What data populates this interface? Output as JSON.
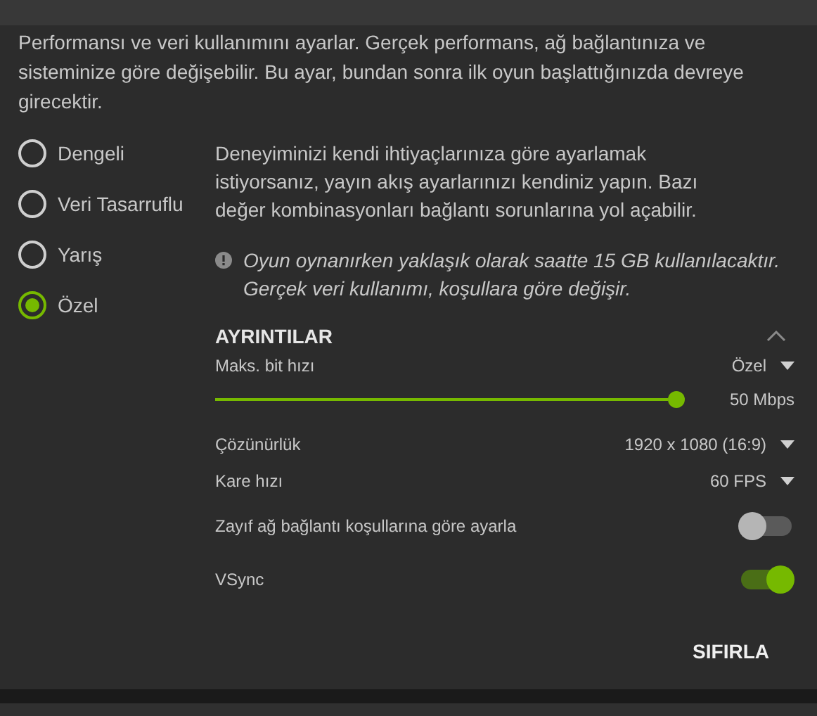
{
  "description": "Performansı ve veri kullanımını ayarlar. Gerçek performans, ağ bağlantınıza ve sisteminize göre değişebilir. Bu ayar, bundan sonra ilk oyun başlattığınızda devreye girecektir.",
  "presets": [
    {
      "label": "Dengeli",
      "selected": false
    },
    {
      "label": "Veri Tasarruflu",
      "selected": false
    },
    {
      "label": "Yarış",
      "selected": false
    },
    {
      "label": "Özel",
      "selected": true
    }
  ],
  "preset_info": "Deneyiminizi kendi ihtiyaçlarınıza göre ayarlamak istiyorsanız, yayın akış ayarlarınızı kendiniz yapın. Bazı değer kombinasyonları bağlantı sorunlarına yol açabilir.",
  "usage_note": "Oyun oynanırken yaklaşık olarak saatte 15 GB kullanılacaktır. Gerçek veri kullanımı, koşullara göre değişir.",
  "details": {
    "title": "AYRINTILAR",
    "expanded": true,
    "rows": [
      {
        "kind": "select",
        "label": "Maks. bit hızı",
        "value": "Özel"
      },
      {
        "kind": "slider",
        "level": 1,
        "reading": "50 Mbps"
      },
      {
        "kind": "select",
        "label": "Çözünürlük",
        "value": "1920 x 1080 (16:9)"
      },
      {
        "kind": "select",
        "label": "Kare hızı",
        "value": "60 FPS"
      },
      {
        "kind": "toggle",
        "label": "Zayıf ağ bağlantı koşullarına göre ayarla",
        "on": false
      },
      {
        "kind": "toggle",
        "label": "VSync",
        "on": true
      }
    ]
  },
  "reset_button": "SIFIRLA"
}
